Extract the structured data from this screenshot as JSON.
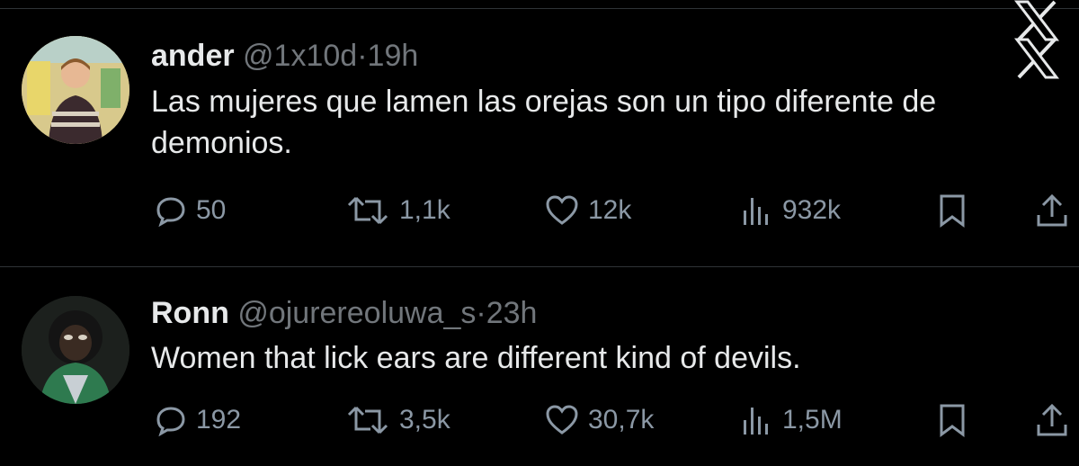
{
  "tweets": [
    {
      "name": "ander",
      "handle": "@1x10d",
      "dot": "·",
      "time": "19h",
      "text": "Las mujeres que lamen las orejas son un tipo diferente de demonios.",
      "replies": "50",
      "retweets": "1,1k",
      "likes": "12k",
      "views": "932k"
    },
    {
      "name": "Ronn",
      "handle": "@ojurereoluwa_s",
      "dot": "·",
      "time": "23h",
      "text": "Women that lick ears are different kind of devils.",
      "replies": "192",
      "retweets": "3,5k",
      "likes": "30,7k",
      "views": "1,5M"
    }
  ],
  "icons": [
    "reply-icon",
    "retweet-icon",
    "like-icon",
    "views-icon",
    "bookmark-icon",
    "share-icon",
    "x-logo-icon"
  ],
  "colors": {
    "background": "#000000",
    "text": "#e7e9ea",
    "muted": "#71767b",
    "icon": "#8b98a5"
  }
}
